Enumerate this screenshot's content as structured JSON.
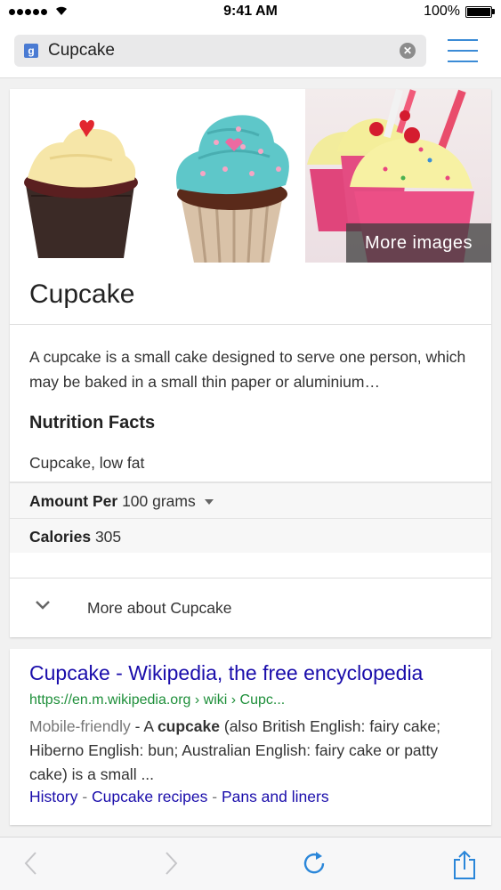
{
  "status_bar": {
    "time": "9:41 AM",
    "battery": "100%"
  },
  "search": {
    "query": "Cupcake",
    "engine_badge": "g"
  },
  "knowledge_card": {
    "more_images_label": "More images",
    "title": "Cupcake",
    "description": "A cupcake is a small cake designed to serve one person, which may be baked in a small thin paper or aluminium…",
    "nutrition_heading": "Nutrition Facts",
    "nutrition_subject": "Cupcake, low fat",
    "amount_label": "Amount Per",
    "amount_value": "100 grams",
    "calories_label": "Calories",
    "calories_value": "305",
    "more_about": "More about Cupcake"
  },
  "result": {
    "title": "Cupcake - Wikipedia, the free encyclopedia",
    "url": "https://en.m.wikipedia.org › wiki › Cupc...",
    "mobile_friendly": "Mobile-friendly",
    "snippet_1": " - A ",
    "snippet_bold": "cupcake",
    "snippet_2": " (also British English: fairy cake; Hiberno English: bun; Australian English: fairy cake or patty cake) is a small ...",
    "links": [
      "History",
      "Cupcake recipes",
      "Pans and liners"
    ],
    "link_separator": " - "
  },
  "toolbar": {
    "icons": [
      "back-icon",
      "forward-icon",
      "reload-icon",
      "share-icon"
    ]
  },
  "colors": {
    "link_blue": "#1a0dab",
    "url_green": "#1e8f3a",
    "accent_blue": "#3b8bd6"
  }
}
